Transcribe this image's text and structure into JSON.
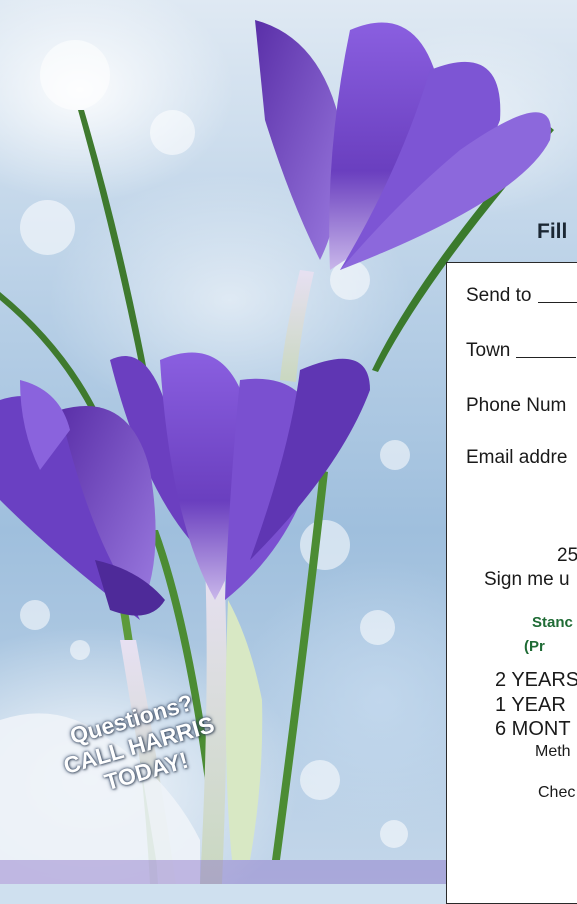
{
  "form": {
    "title": "Fill",
    "fields": {
      "send_to": "Send to",
      "town": "Town",
      "phone": "Phone Num",
      "email": "Email addre"
    },
    "price_fragment": "25",
    "signup_fragment": "Sign me u",
    "standard_fragment": "Stanc",
    "preferred_fragment": "(Pr",
    "plans": [
      "2 YEARS",
      "1 YEAR",
      "6 MONT"
    ],
    "method_fragment": "Meth",
    "check_fragment": "Chec"
  },
  "callout": {
    "line1": "Questions?",
    "line2": "CALL HARRIS",
    "line3": "TODAY!"
  },
  "colors": {
    "accent_green": "#1f6b35",
    "flower_purple": "#7b4fc9"
  }
}
